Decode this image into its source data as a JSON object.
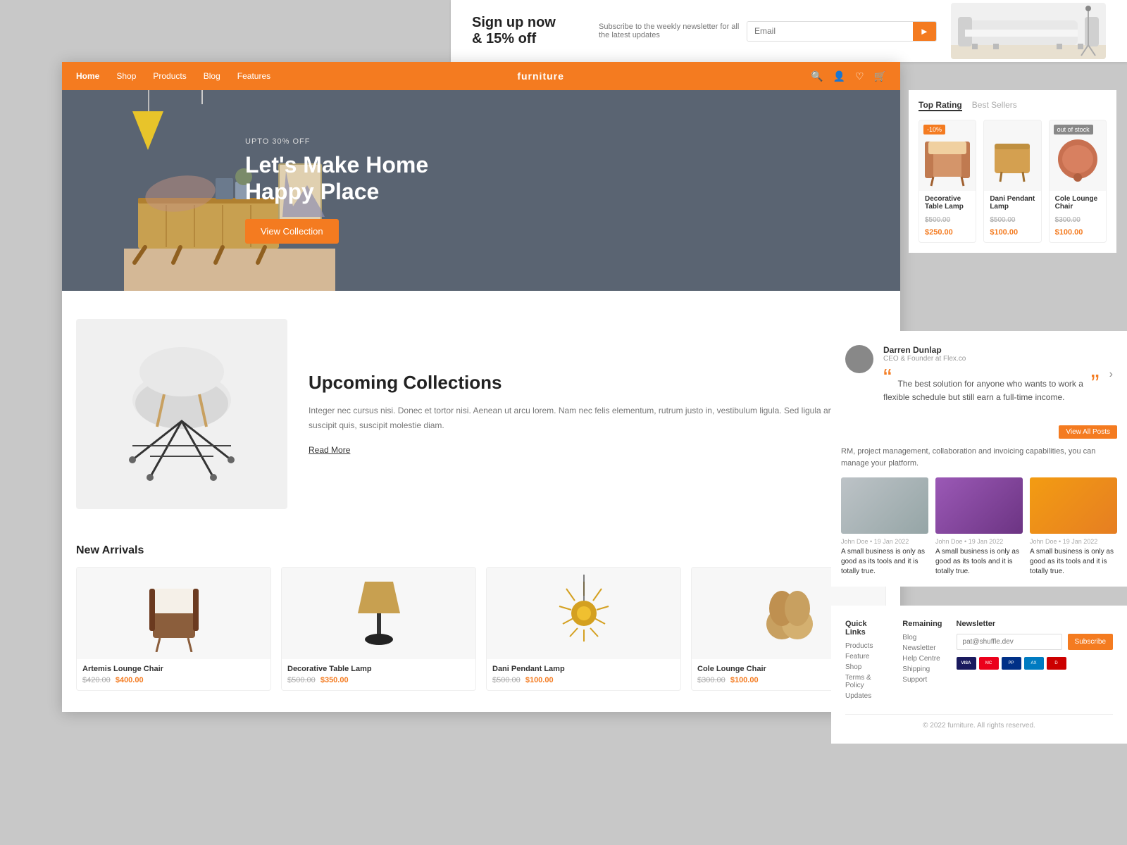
{
  "newsletter": {
    "title": "Sign up now",
    "subtitle": "& 15% off",
    "description": "Subscribe to the weekly newsletter for all the latest updates",
    "input_placeholder": "Email",
    "send_icon": "▶"
  },
  "navbar": {
    "logo": "furniture",
    "links": [
      "Home",
      "Shop",
      "Products",
      "Blog",
      "Features"
    ],
    "active_link": "Home"
  },
  "hero": {
    "promo": "UPTO 30% OFF",
    "title_line1": "Let's Make Home",
    "title_line2": "Happy Place",
    "cta_label": "View Collection"
  },
  "products_tabs": {
    "tab1": "Top Rating",
    "tab2": "Best Sellers"
  },
  "products": [
    {
      "name": "Decorative Table Lamp",
      "old_price": "$500.00",
      "new_price": "$250.00",
      "badge": "-10%",
      "badge_type": "sale"
    },
    {
      "name": "Dani Pendant Lamp",
      "old_price": "$500.00",
      "new_price": "$100.00",
      "badge": "",
      "badge_type": ""
    },
    {
      "name": "Cole Lounge Chair",
      "old_price": "$300.00",
      "new_price": "$100.00",
      "badge": "out of stock",
      "badge_type": "oos"
    }
  ],
  "testimonial": {
    "name": "Darren Dunlap",
    "role": "CEO & Founder at Flex.co",
    "text": "The best solution for anyone who wants to work a flexible schedule but still earn a full-time income."
  },
  "upcoming": {
    "title": "Upcoming Collections",
    "description": "Integer nec cursus nisi. Donec et tortor nisi. Aenean ut arcu lorem. Nam nec felis elementum, rutrum justo in, vestibulum ligula. Sed ligula ante gravida in suscipit quis, suscipit molestie diam.",
    "read_more": "Read More"
  },
  "new_arrivals": {
    "title": "New Arrivals",
    "products": [
      {
        "name": "Artemis Lounge Chair",
        "old_price": "$420.00",
        "new_price": "$400.00"
      },
      {
        "name": "Decorative Table Lamp",
        "old_price": "$500.00",
        "new_price": "$350.00"
      },
      {
        "name": "Dani Pendant Lamp",
        "old_price": "$500.00",
        "new_price": "$100.00"
      },
      {
        "name": "Cole Lounge Chair",
        "old_price": "$300.00",
        "new_price": "$100.00"
      }
    ]
  },
  "blog": {
    "view_all": "View All Posts",
    "description": "RM, project management, collaboration and invoicing capabilities, you can manage your platform.",
    "posts": [
      {
        "author": "John Doe",
        "date": "19 Jan 2022",
        "title": "A small business is only as good as its tools and it is totally true.",
        "img_type": "desk"
      },
      {
        "author": "John Doe",
        "date": "19 Jan 2022",
        "title": "A small business is only as good as its tools and it is totally true.",
        "img_type": "purple"
      },
      {
        "author": "John Doe",
        "date": "19 Jan 2022",
        "title": "A small business is only as good as its tools and it is totally true.",
        "img_type": "orange-hand"
      }
    ]
  },
  "footer": {
    "quick_links": {
      "title": "Quick Links",
      "items": [
        "Products",
        "Feature",
        "Shop",
        "Terms & Policy",
        "Updates"
      ]
    },
    "remaining": {
      "title": "Remaining",
      "items": [
        "Blog",
        "Newsletter",
        "Help Centre",
        "Shipping",
        "Support"
      ]
    },
    "newsletter": {
      "title": "Newsletter",
      "placeholder": "pat@shuffle.dev",
      "btn": "Subscribe"
    },
    "copyright": "© 2022 furniture. All rights reserved."
  }
}
